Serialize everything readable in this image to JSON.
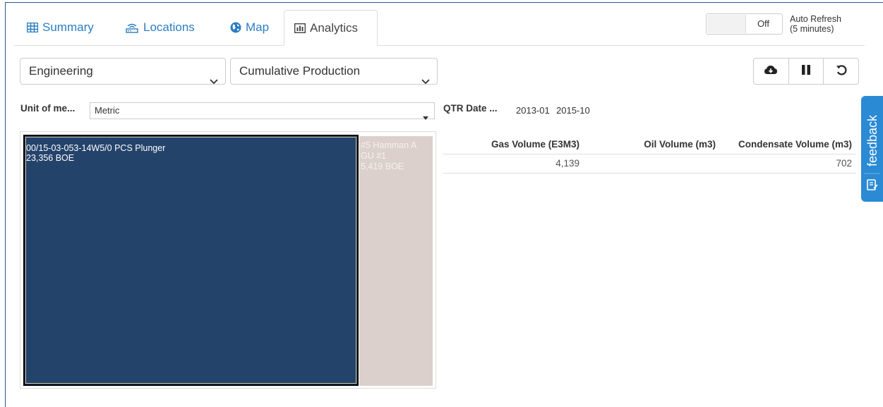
{
  "tabs": [
    {
      "label": "Summary",
      "icon": "table-icon"
    },
    {
      "label": "Locations",
      "icon": "router-icon"
    },
    {
      "label": "Map",
      "icon": "globe-icon"
    },
    {
      "label": "Analytics",
      "icon": "bar-chart-icon"
    }
  ],
  "active_tab": "Analytics",
  "auto_refresh": {
    "state": "Off",
    "label_line1": "Auto Refresh",
    "label_line2": "(5 minutes)"
  },
  "dropdowns": {
    "view": "Engineering",
    "metric": "Cumulative Production"
  },
  "toolbar_icons": [
    "cloud-download-icon",
    "pause-icon",
    "undo-icon"
  ],
  "filters": {
    "uom_label": "Unit of me...",
    "uom_value": "Metric",
    "qtr_label": "QTR Date ...",
    "qtr_from": "2013-01",
    "qtr_to": "2015-10"
  },
  "treemap": {
    "colors": {
      "primary": "#24436b",
      "secondary": "#dcd0cc"
    },
    "cells": [
      {
        "line1": "00/15-03-053-14W5/0 PCS Plunger",
        "line2": "23,356 BOE",
        "boe": 23356
      },
      {
        "line1": "#5 Hamman A",
        "line2": "GU #1",
        "line3": "5,419 BOE",
        "boe": 5419
      }
    ]
  },
  "table": {
    "headers": [
      "Gas Volume (E3M3)",
      "Oil Volume (m3)",
      "Condensate Volume (m3)"
    ],
    "rows": [
      [
        "4,139",
        "",
        "702"
      ]
    ]
  },
  "feedback": {
    "label": "feedback"
  }
}
